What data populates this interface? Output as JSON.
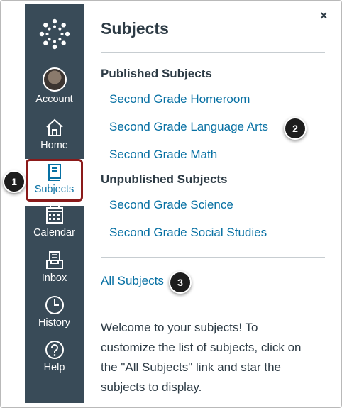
{
  "nav": {
    "account_label": "Account",
    "home_label": "Home",
    "subjects_label": "Subjects",
    "calendar_label": "Calendar",
    "inbox_label": "Inbox",
    "history_label": "History",
    "help_label": "Help",
    "bg_color": "#394b58",
    "active_color": "#0770a3"
  },
  "tray": {
    "title": "Subjects",
    "close_glyph": "×",
    "published_heading": "Published Subjects",
    "published": [
      "Second Grade Homeroom",
      "Second Grade Language Arts",
      "Second Grade Math"
    ],
    "unpublished_heading": "Unpublished Subjects",
    "unpublished": [
      "Second Grade Science",
      "Second Grade Social Studies"
    ],
    "all_link": "All Subjects",
    "welcome": "Welcome to your subjects! To customize the list of subjects, click on the \"All Subjects\" link and star the subjects to display."
  },
  "callouts": [
    "1",
    "2",
    "3"
  ]
}
